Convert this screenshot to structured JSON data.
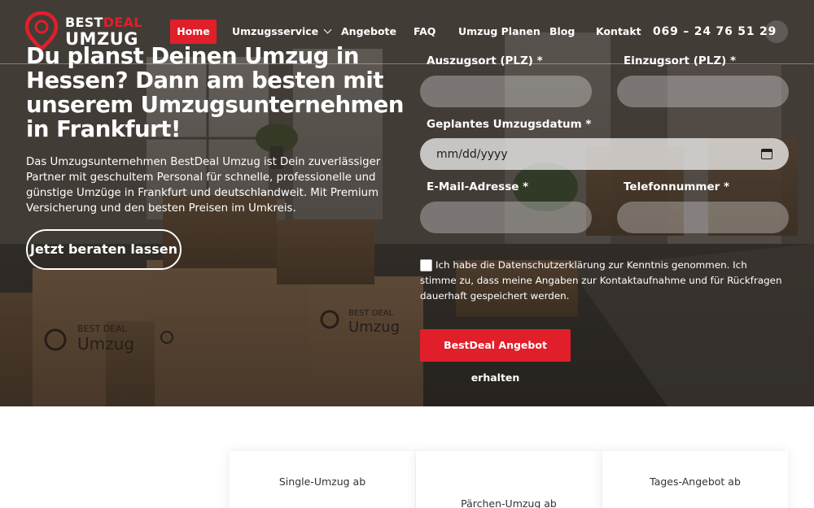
{
  "brand": {
    "logo_best": "BEST",
    "logo_deal": "DEAL",
    "logo_umzug": "UMZUG",
    "accent_color": "#e01f2a"
  },
  "nav": {
    "items": [
      {
        "label": "Home",
        "active": true
      },
      {
        "label": "Umzugsservice",
        "has_dropdown": true
      },
      {
        "label": "Angebote"
      },
      {
        "label": "FAQ"
      },
      {
        "label": "Umzug Planen"
      },
      {
        "label": "Blog"
      },
      {
        "label": "Kontakt"
      }
    ],
    "phone": "069 – 24 76 51 29"
  },
  "hero": {
    "title": "Du planst Deinen Umzug in Hessen? Dann am besten mit unserem Umzugsunternehmen in Frankfurt!",
    "text": "Das Umzugsunternehmen BestDeal Umzug ist Dein zuverlässiger Partner mit geschultem Personal für schnelle, professionelle und günstige Umzüge in Frankfurt und deutschlandweit. Mit Premium Versicherung und den besten Preisen im Umkreis.",
    "cta_label": "Jetzt beraten lassen",
    "box_print_1": "BEST DEAL",
    "box_print_2": "Umzug"
  },
  "form": {
    "from_label": "Auszugsort (PLZ) *",
    "to_label": "Einzugsort (PLZ) *",
    "date_label": "Geplantes Umzugsdatum *",
    "date_placeholder": "mm/dd/yyyy",
    "email_label": "E-Mail-Adresse *",
    "phone_label": "Telefonnummer *",
    "consent_text": "Ich habe die Datenschutzerklärung zur Kenntnis genommen. Ich stimme zu, dass meine Angaben zur Kontaktaufnahme und für Rückfragen dauerhaft gespeichert werden.",
    "submit_label": "BestDeal Angebot erhalten"
  },
  "offers": [
    {
      "label": "Single-Umzug ab"
    },
    {
      "label": "Pärchen-Umzug ab"
    },
    {
      "label": "Tages-Angebot ab"
    }
  ]
}
